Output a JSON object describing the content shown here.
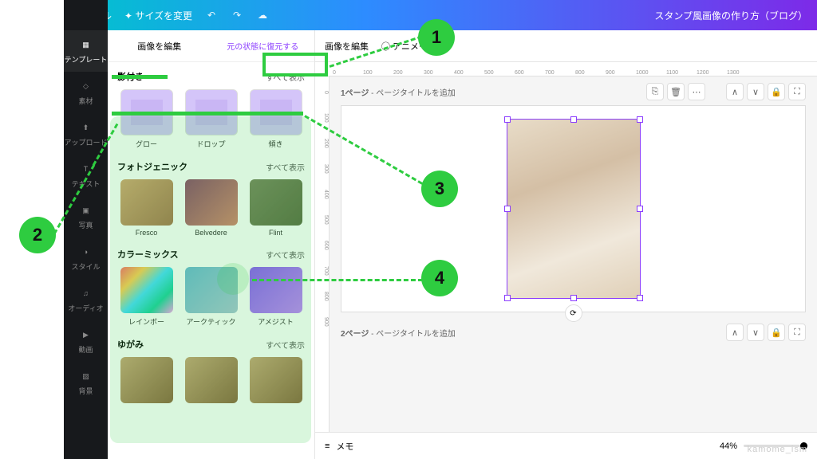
{
  "topbar": {
    "file": "ファイル",
    "resize": "サイズを変更",
    "title": "スタンプ風画像の作り方（ブログ）"
  },
  "sidebar": {
    "items": [
      {
        "label": "テンプレート"
      },
      {
        "label": "素材"
      },
      {
        "label": "アップロード"
      },
      {
        "label": "テキスト"
      },
      {
        "label": "写真"
      },
      {
        "label": "スタイル"
      },
      {
        "label": "オーディオ"
      },
      {
        "label": "動画"
      },
      {
        "label": "背景"
      }
    ]
  },
  "panel": {
    "tab_edit": "画像を編集",
    "tab_restore": "元の状態に復元する",
    "btn_edit": "画像を編集",
    "view_all": "すべて表示",
    "sections": {
      "shadow": {
        "title": "影付き",
        "items": [
          "グロー",
          "ドロップ",
          "傾き"
        ]
      },
      "photogenic": {
        "title": "フォトジェニック",
        "items": [
          "Fresco",
          "Belvedere",
          "Flint"
        ]
      },
      "colormix": {
        "title": "カラーミックス",
        "items": [
          "レインボー",
          "アークティック",
          "アメジスト"
        ]
      },
      "distort": {
        "title": "ゆがみ"
      }
    }
  },
  "toolbar": {
    "edit_image": "画像を編集",
    "animate": "アニメート"
  },
  "ruler": [
    "0",
    "100",
    "200",
    "300",
    "400",
    "500",
    "600",
    "700",
    "800",
    "900",
    "1000",
    "1100",
    "1200",
    "1300"
  ],
  "rulerV": [
    "0",
    "100",
    "200",
    "300",
    "400",
    "500",
    "600",
    "700",
    "800",
    "900"
  ],
  "pages": {
    "p1": "1ページ",
    "p2": "2ページ",
    "subtitle": "- ページタイトルを追加"
  },
  "bottom": {
    "memo": "メモ",
    "zoom": "44%"
  },
  "annotations": {
    "n1": "1",
    "n2": "2",
    "n3": "3",
    "n4": "4"
  },
  "watermark": "kamome_ism"
}
